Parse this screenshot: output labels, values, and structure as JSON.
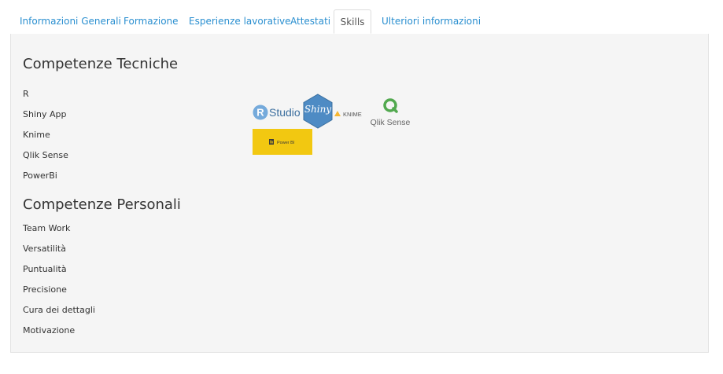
{
  "tabs": [
    {
      "label": "Informazioni Generali"
    },
    {
      "label": "Formazione"
    },
    {
      "label": "Esperienze lavorative"
    },
    {
      "label": "Attestati"
    },
    {
      "label": "Skills"
    },
    {
      "label": "Ulteriori informazioni"
    }
  ],
  "active_tab": "Skills",
  "technical": {
    "title": "Competenze Tecniche",
    "items": [
      "R",
      "Shiny App",
      "Knime",
      "Qlik Sense",
      "PowerBi"
    ]
  },
  "personal": {
    "title": "Competenze Personali",
    "items": [
      "Team Work",
      "Versatilità",
      "Puntualità",
      "Precisione",
      "Cura dei dettagli",
      "Motivazione"
    ]
  },
  "logos": {
    "rstudio": {
      "badge": "R",
      "text": "Studio"
    },
    "shiny": {
      "text": "Shiny"
    },
    "knime": {
      "text": "KNIME"
    },
    "qlik": {
      "text": "Qlik Sense"
    },
    "powerbi": {
      "text": "Power BI"
    }
  },
  "colors": {
    "link": "#2a8fd0",
    "panel_bg": "#f5f5f5",
    "rstudio_blue": "#75aadb",
    "shiny_blue": "#4e8bc4",
    "qlik_green": "#52a94f",
    "powerbi_yellow": "#f2c811"
  }
}
